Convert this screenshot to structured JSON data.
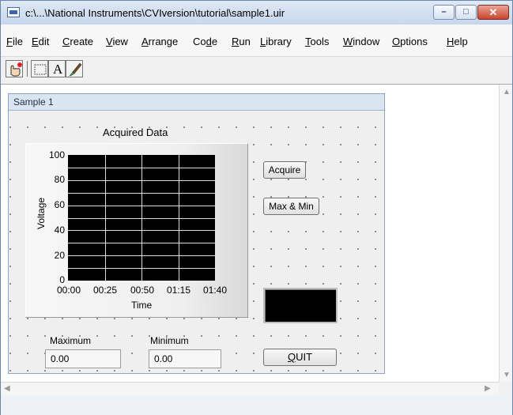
{
  "window": {
    "title": "c:\\...\\National Instruments\\CVIversion\\tutorial\\sample1.uir",
    "controls": {
      "minimize": "–",
      "maximize": "□",
      "close": "✕"
    }
  },
  "menubar": [
    {
      "label": "File",
      "underline": "F",
      "rest": "ile"
    },
    {
      "label": "Edit",
      "underline": "E",
      "rest": "dit"
    },
    {
      "label": "Create",
      "underline": "C",
      "rest": "reate"
    },
    {
      "label": "View",
      "underline": "V",
      "rest": "iew"
    },
    {
      "label": "Arrange",
      "underline": "A",
      "rest": "rrange"
    },
    {
      "label": "Code",
      "pre": "Co",
      "underline": "d",
      "rest": "e"
    },
    {
      "label": "Run",
      "underline": "R",
      "rest": "un"
    },
    {
      "label": "Library",
      "underline": "L",
      "rest": "ibrary"
    },
    {
      "label": "Tools",
      "underline": "T",
      "rest": "ools"
    },
    {
      "label": "Window",
      "underline": "W",
      "rest": "indow"
    },
    {
      "label": "Options",
      "underline": "O",
      "rest": "ptions"
    },
    {
      "label": "Help",
      "underline": "H",
      "rest": "elp"
    }
  ],
  "toolbar": {
    "tools": [
      "operate-tool-icon",
      "select-rectangle-icon",
      "text-label-tool-icon",
      "color-brush-icon"
    ],
    "label_tool_text": "A"
  },
  "panel": {
    "title": "Sample 1",
    "graph": {
      "title": "Acquired Data",
      "x_label": "Time",
      "y_label": "Voltage",
      "y_ticks": [
        "100",
        "80",
        "60",
        "40",
        "20",
        "0"
      ],
      "x_ticks": [
        "00:00",
        "00:25",
        "00:50",
        "01:15",
        "01:40"
      ]
    },
    "buttons": {
      "acquire": "Acquire",
      "maxmin": "Max & Min",
      "quit_pre": "",
      "quit_underline": "Q",
      "quit_rest": "UIT"
    },
    "maximum": {
      "label": "Maximum",
      "value": "0.00"
    },
    "minimum": {
      "label": "Minimum",
      "value": "0.00"
    }
  },
  "scrollbars": {
    "up": "▲",
    "down": "▼",
    "left": "◀",
    "right": "▶"
  },
  "colors": {
    "plot_background": "#000000",
    "grid": "#dcdcdc",
    "window_frame": "#6d84a6"
  }
}
